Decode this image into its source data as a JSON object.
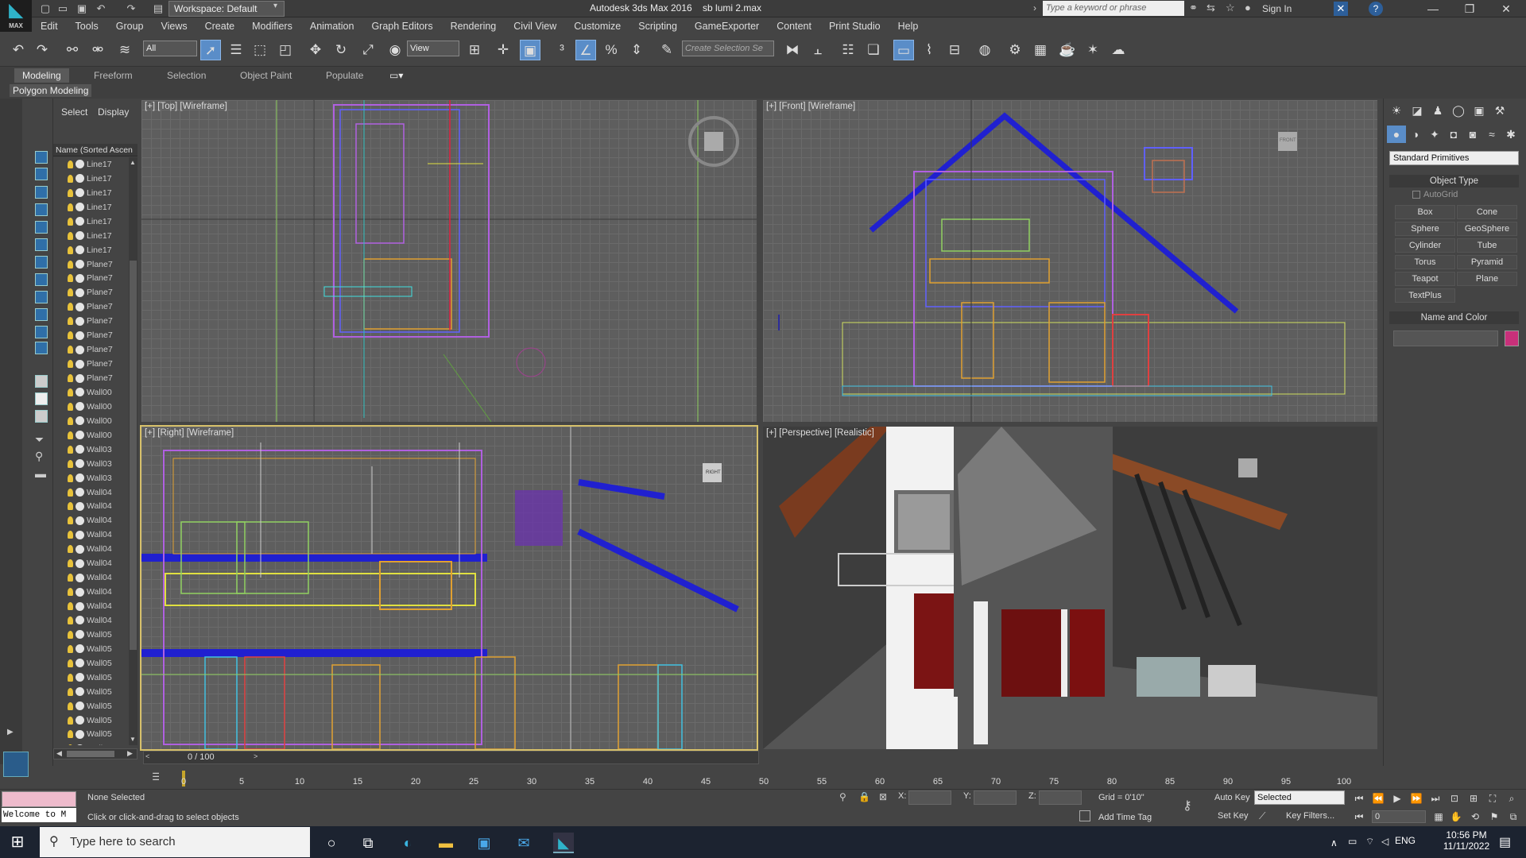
{
  "app": {
    "title": "Autodesk 3ds Max 2016",
    "file": "sb lumi 2.max",
    "workspace": "Workspace: Default",
    "search_placeholder": "Type a keyword or phrase",
    "sign_in": "Sign In"
  },
  "menu": [
    "Edit",
    "Tools",
    "Group",
    "Views",
    "Create",
    "Modifiers",
    "Animation",
    "Graph Editors",
    "Rendering",
    "Civil View",
    "Customize",
    "Scripting",
    "GameExporter",
    "Content",
    "Print Studio",
    "Help"
  ],
  "toolbar": {
    "selection_filter": "All",
    "ref_coord": "View",
    "named_selection_placeholder": "Create Selection Se"
  },
  "ribbon": {
    "tabs": [
      "Modeling",
      "Freeform",
      "Selection",
      "Object Paint",
      "Populate"
    ],
    "active_tab": "Modeling",
    "panel_label": "Polygon Modeling"
  },
  "scene_explorer": {
    "tabs": [
      "Select",
      "Display"
    ],
    "column_header": "Name (Sorted Ascen",
    "objects": [
      "Line17",
      "Line17",
      "Line17",
      "Line17",
      "Line17",
      "Line17",
      "Line17",
      "Plane7",
      "Plane7",
      "Plane7",
      "Plane7",
      "Plane7",
      "Plane7",
      "Plane7",
      "Plane7",
      "Plane7",
      "Wall00",
      "Wall00",
      "Wall00",
      "Wall00",
      "Wall03",
      "Wall03",
      "Wall03",
      "Wall04",
      "Wall04",
      "Wall04",
      "Wall04",
      "Wall04",
      "Wall04",
      "Wall04",
      "Wall04",
      "Wall04",
      "Wall04",
      "Wall05",
      "Wall05",
      "Wall05",
      "Wall05",
      "Wall05",
      "Wall05",
      "Wall05",
      "Wall05",
      "Wall05",
      "Wall05"
    ]
  },
  "viewports": {
    "top": "[+] [Top] [Wireframe]",
    "front": "[+] [Front] [Wireframe]",
    "right": "[+] [Right] [Wireframe]",
    "perspective": "[+] [Perspective] [Realistic]",
    "right_cube_label": "RIGHT",
    "front_cube_label": "FRONT"
  },
  "command_panel": {
    "category": "Standard Primitives",
    "object_type_title": "Object Type",
    "autogrid": "AutoGrid",
    "primitives": [
      "Box",
      "Cone",
      "Sphere",
      "GeoSphere",
      "Cylinder",
      "Tube",
      "Torus",
      "Pyramid",
      "Teapot",
      "Plane",
      "TextPlus"
    ],
    "name_color_title": "Name and Color",
    "object_color": "#c8307a"
  },
  "timeline": {
    "slider": "0 / 100",
    "ticks": [
      "0",
      "5",
      "10",
      "15",
      "20",
      "25",
      "30",
      "35",
      "40",
      "45",
      "50",
      "55",
      "60",
      "65",
      "70",
      "75",
      "80",
      "85",
      "90",
      "95",
      "100"
    ]
  },
  "status": {
    "selection": "None Selected",
    "prompt": "Click or click-and-drag to select objects",
    "welcome": "Welcome to M",
    "x_label": "X:",
    "y_label": "Y:",
    "z_label": "Z:",
    "grid": "Grid = 0'10\"",
    "add_time_tag": "Add Time Tag",
    "auto_key": "Auto Key",
    "set_key": "Set Key",
    "key_mode": "Selected",
    "key_filters": "Key Filters...",
    "frame": "0"
  },
  "taskbar": {
    "search_placeholder": "Type here to search",
    "language": "ENG",
    "time": "10:56 PM",
    "date": "11/11/2022"
  }
}
